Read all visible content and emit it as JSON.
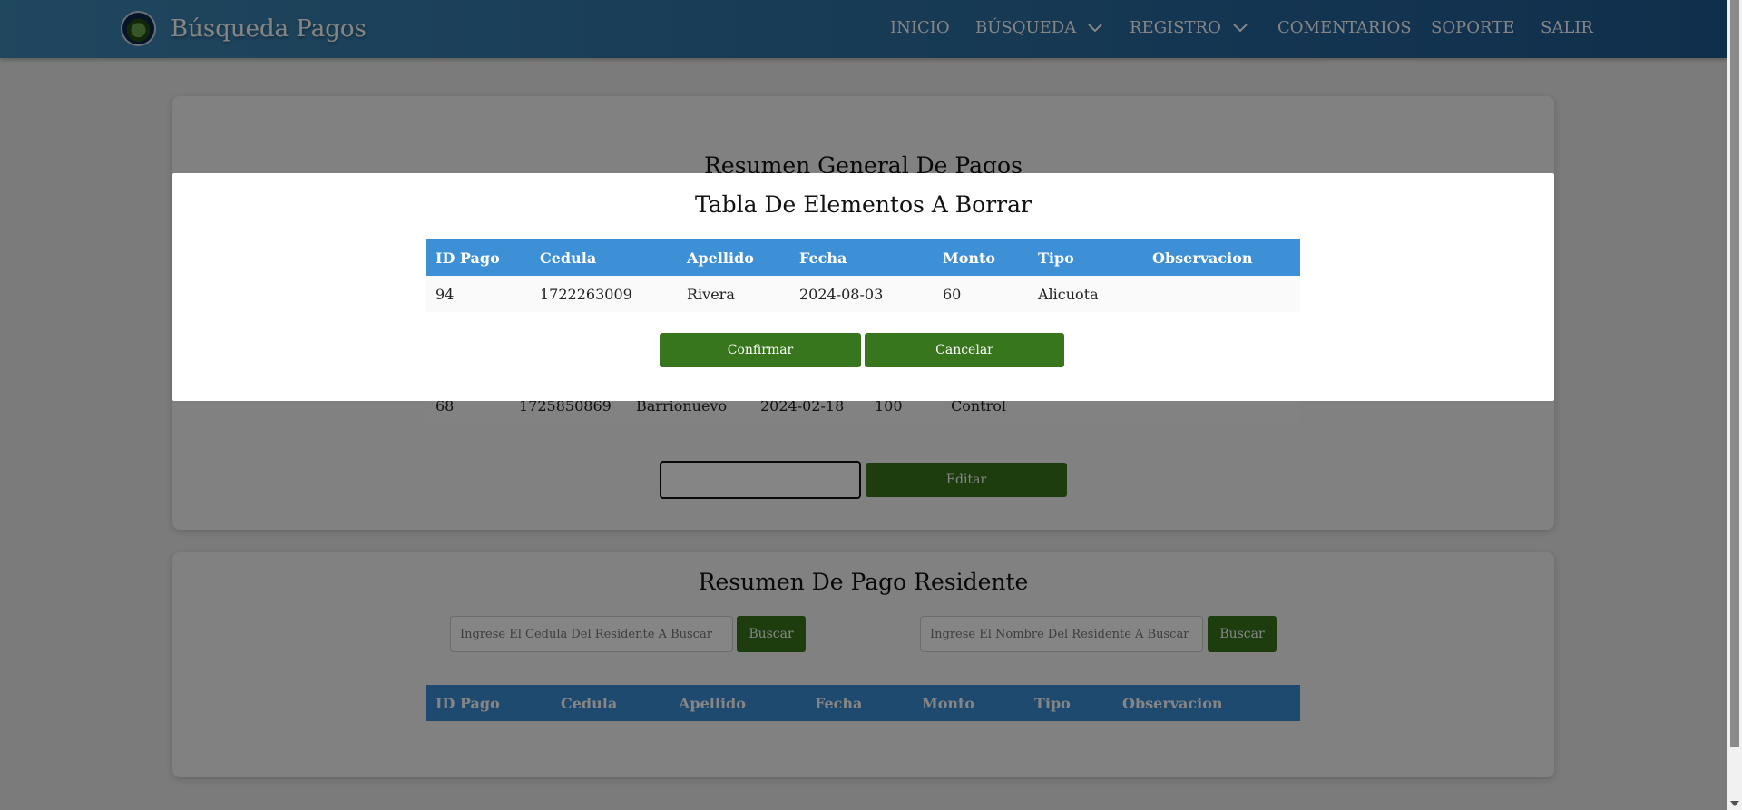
{
  "header": {
    "title": "Búsqueda Pagos",
    "nav": {
      "inicio": "INICIO",
      "busqueda": "BÚSQUEDA",
      "registro": "REGISTRO",
      "comentarios": "COMENTARIOS",
      "soporte": "SOPORTE",
      "salir": "SALIR"
    }
  },
  "general": {
    "title": "Resumen General De Pagos",
    "visible_row": {
      "id": "68",
      "cedula": "1725850869",
      "apellido": "Barrionuevo",
      "fecha": "2024-02-18",
      "monto": "100",
      "tipo": "Control"
    },
    "edit_input_value": "",
    "edit_label": "Editar"
  },
  "resident": {
    "title": "Resumen De Pago Residente",
    "cedula_placeholder": "Ingrese El Cedula Del Residente A Buscar",
    "nombre_placeholder": "Ingrese El Nombre Del Residente A Buscar",
    "buscar_label": "Buscar",
    "columns": [
      "ID Pago",
      "Cedula",
      "Apellido",
      "Fecha",
      "Monto",
      "Tipo",
      "Observacion"
    ]
  },
  "modal": {
    "title": "Tabla De Elementos A Borrar",
    "columns": [
      "ID Pago",
      "Cedula",
      "Apellido",
      "Fecha",
      "Monto",
      "Tipo",
      "Observacion"
    ],
    "rows": [
      {
        "id": "94",
        "cedula": "1722263009",
        "apellido": "Rivera",
        "fecha": "2024-08-03",
        "monto": "60",
        "tipo": "Alicuota",
        "observacion": ""
      }
    ],
    "confirm_label": "Confirmar",
    "cancel_label": "Cancelar"
  },
  "colors": {
    "header_start": "#3d88b5",
    "header_end": "#1f5a92",
    "table_header": "#3d8fd6",
    "button_green": "#38761d"
  },
  "icons": {
    "logo": "community-seal-logo",
    "dropdown": "chevron-down-icon"
  }
}
